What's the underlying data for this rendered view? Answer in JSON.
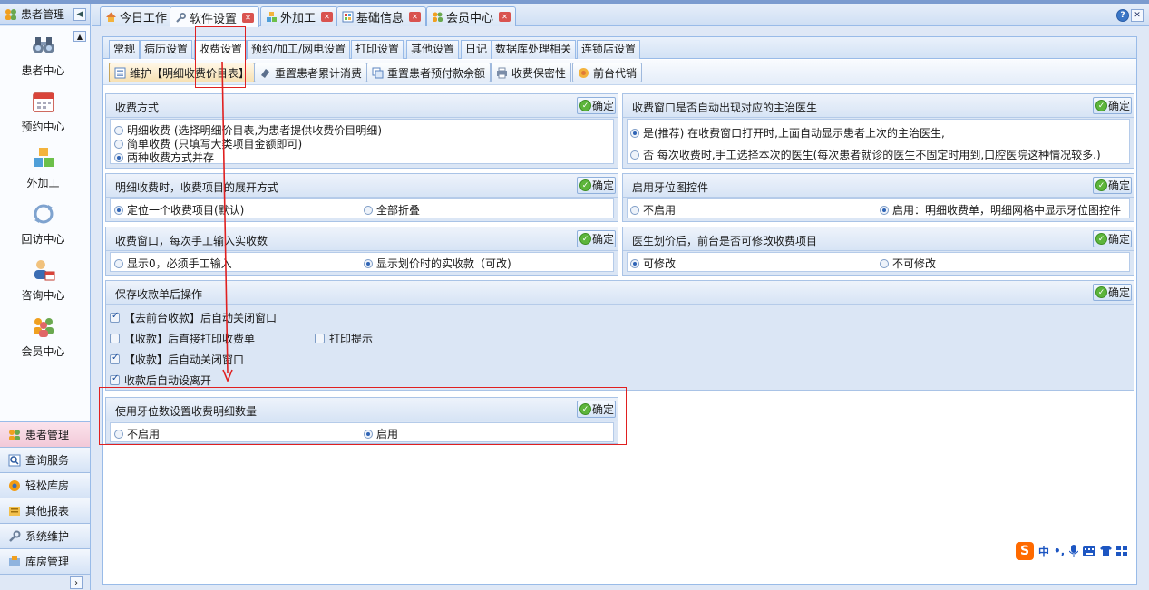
{
  "sidebar": {
    "title": "患者管理",
    "modules": [
      {
        "label": "患者中心",
        "icon": "binoculars-icon"
      },
      {
        "label": "预约中心",
        "icon": "calendar-icon"
      },
      {
        "label": "外加工",
        "icon": "cubes-icon"
      },
      {
        "label": "回访中心",
        "icon": "refresh-icon"
      },
      {
        "label": "咨询中心",
        "icon": "consult-icon"
      },
      {
        "label": "会员中心",
        "icon": "members-icon"
      }
    ],
    "accordion": [
      {
        "label": "患者管理",
        "icon": "patients-icon"
      },
      {
        "label": "查询服务",
        "icon": "query-icon"
      },
      {
        "label": "轻松库房",
        "icon": "warehouse-icon"
      },
      {
        "label": "其他报表",
        "icon": "report-icon"
      },
      {
        "label": "系统维护",
        "icon": "wrench-icon"
      },
      {
        "label": "库房管理",
        "icon": "storage-icon"
      }
    ]
  },
  "tabs": [
    {
      "label": "今日工作",
      "icon": "home-icon",
      "closable": false
    },
    {
      "label": "软件设置",
      "icon": "wrench-icon",
      "closable": true
    },
    {
      "label": "外加工",
      "icon": "cubes-icon",
      "closable": true
    },
    {
      "label": "基础信息",
      "icon": "info-icon",
      "closable": true
    },
    {
      "label": "会员中心",
      "icon": "members-icon",
      "closable": true
    }
  ],
  "subtabs": [
    "常规",
    "病历设置",
    "收费设置",
    "预约/加工/网电设置",
    "打印设置",
    "其他设置",
    "日记",
    "数据库处理相关",
    "连锁店设置"
  ],
  "toolbar": [
    "维护【明细收费价目表】",
    "重置患者累计消费",
    "重置患者预付款余额",
    "收费保密性",
    "前台代销"
  ],
  "confirm_label": "确定",
  "groups": {
    "fee_mode": {
      "title": "收费方式",
      "options": [
        "明细收费 (选择明细价目表,为患者提供收费价目明细)",
        "简单收费 (只填写大类项目金额即可)",
        "两种收费方式并存"
      ],
      "selected": 2
    },
    "doctor_display": {
      "title": "收费窗口是否自动出现对应的主治医生",
      "options": [
        "是(推荐)   在收费窗口打开时,上面自动显示患者上次的主治医生,",
        "否    每次收费时,手工选择本次的医生(每次患者就诊的医生不固定时用到,口腔医院这种情况较多.)"
      ],
      "selected": 0
    },
    "expand_mode": {
      "title": "明细收费时，收费项目的展开方式",
      "options": [
        "定位一个收费项目(默认)",
        "全部折叠"
      ],
      "selected": 0
    },
    "tooth_chart": {
      "title": "启用牙位图控件",
      "options": [
        "不启用",
        "启用：明细收费单，明细网格中显示牙位图控件"
      ],
      "selected": 1
    },
    "manual_input": {
      "title": "收费窗口，每次手工输入实收数",
      "options": [
        "显示0，必须手工输入",
        "显示划价时的实收款（可改)"
      ],
      "selected": 1
    },
    "modify_items": {
      "title": "医生划价后，前台是否可修改收费项目",
      "options": [
        "可修改",
        "不可修改"
      ],
      "selected": 0
    },
    "after_save": {
      "title": "保存收款单后操作",
      "checks": [
        {
          "label": "【去前台收款】后自动关闭窗口",
          "checked": true
        },
        {
          "label": "【收款】后直接打印收费单",
          "checked": false
        },
        {
          "label": "打印提示",
          "checked": false
        },
        {
          "label": "【收款】后自动关闭窗口",
          "checked": true
        },
        {
          "label": "收款后自动设离开",
          "checked": true
        }
      ]
    },
    "tooth_count": {
      "title": "使用牙位数设置收费明细数量",
      "options": [
        "不启用",
        "启用"
      ],
      "selected": 1
    }
  },
  "ime": {
    "logo": "S",
    "lang": "中"
  }
}
